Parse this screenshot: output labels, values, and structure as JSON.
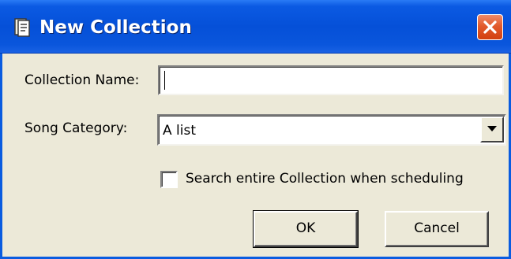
{
  "window": {
    "title": "New Collection",
    "title_icon": "collection-icon",
    "close_icon": "close-icon"
  },
  "form": {
    "collection_name_label": "Collection Name:",
    "collection_name_value": "",
    "song_category_label": "Song Category:",
    "song_category_value": "A list",
    "dropdown_icon": "chevron-down-icon",
    "search_checkbox_label": "Search entire Collection when scheduling",
    "search_checkbox_checked": false
  },
  "buttons": {
    "ok_label": "OK",
    "cancel_label": "Cancel"
  },
  "colors": {
    "titlebar": "#0550d8",
    "dialog_background": "#ece9d8",
    "close_button": "#e25a2c"
  }
}
